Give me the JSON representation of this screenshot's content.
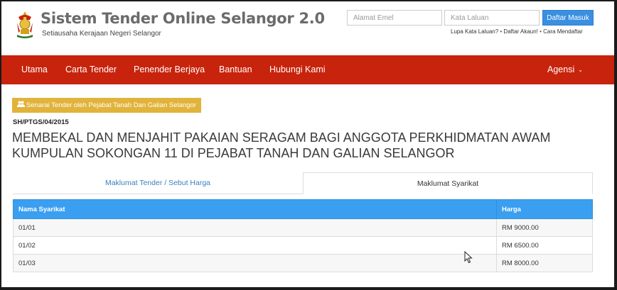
{
  "header": {
    "title": "Sistem Tender Online Selangor 2.0",
    "subtitle": "Setiausaha Kerajaan Negeri Selangor",
    "logo_icon": "selangor-crest-icon",
    "login": {
      "email_placeholder": "Alamat Emel",
      "password_placeholder": "Kata Laluan",
      "submit_label": "Daftar Masuk",
      "forgot_label": "Lupa Kata Laluan?",
      "register_label": "Daftar Akaun!",
      "howto_label": "Cara Mendaftar",
      "separator": " • "
    }
  },
  "navbar": {
    "items": [
      {
        "label": "Utama"
      },
      {
        "label": "Carta Tender"
      },
      {
        "label": "Penender Berjaya"
      },
      {
        "label": "Bantuan"
      },
      {
        "label": "Hubungi Kami"
      }
    ],
    "agensi_label": "Agensi",
    "agensi_chevron": "⌄"
  },
  "content": {
    "badge_label": "Senarai Tender oleh Pejabat Tanah Dan Galian Selangor",
    "badge_icon": "users-icon",
    "reference": "SH/PTGS/04/2015",
    "title": "MEMBEKAL DAN MENJAHIT PAKAIAN SERAGAM BAGI ANGGOTA PERKHIDMATAN AWAM KUMPULAN SOKONGAN 11 DI PEJABAT TANAH DAN GALIAN SELANGOR"
  },
  "tabs": [
    {
      "label": "Maklumat Tender / Sebut Harga",
      "active": false
    },
    {
      "label": "Maklumat Syarikat",
      "active": true
    }
  ],
  "table": {
    "headers": [
      "Nama Syarikat",
      "Harga"
    ],
    "rows": [
      [
        "01/01",
        "RM 9000.00"
      ],
      [
        "01/02",
        "RM 6500.00"
      ],
      [
        "01/03",
        "RM 8000.00"
      ]
    ]
  },
  "colors": {
    "navbar": "#c8230c",
    "badge": "#e1b33a",
    "table_header": "#3a9ff0",
    "login_button": "#3a8fe0",
    "tab_link": "#3a7fc0"
  }
}
